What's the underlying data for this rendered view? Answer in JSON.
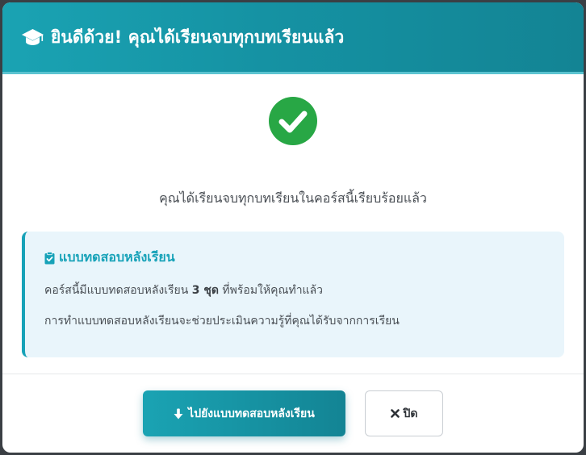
{
  "header": {
    "title": "ยินดีด้วย! คุณได้เรียนจบทุกบทเรียนแล้ว",
    "icon": "graduation-cap-icon"
  },
  "body": {
    "status_icon": "check-circle-icon",
    "lead_text": "คุณได้เรียนจบทุกบทเรียนในคอร์สนี้เรียบร้อยแล้ว",
    "info": {
      "icon": "clipboard-check-icon",
      "title": "แบบทดสอบหลังเรียน",
      "line1_prefix": "คอร์สนี้มีแบบทดสอบหลังเรียน ",
      "line1_count": "3 ชุด",
      "line1_suffix": " ที่พร้อมให้คุณทำแล้ว",
      "line2": "การทำแบบทดสอบหลังเรียนจะช่วยประเมินความรู้ที่คุณได้รับจากการเรียน"
    }
  },
  "footer": {
    "primary_label": "ไปยังแบบทดสอบหลังเรียน",
    "primary_icon": "arrow-down-icon",
    "close_label": "ปิด",
    "close_icon": "close-icon"
  },
  "colors": {
    "accent": "#17a2b8",
    "success": "#28a745",
    "info_bg": "#e9f5fb"
  }
}
